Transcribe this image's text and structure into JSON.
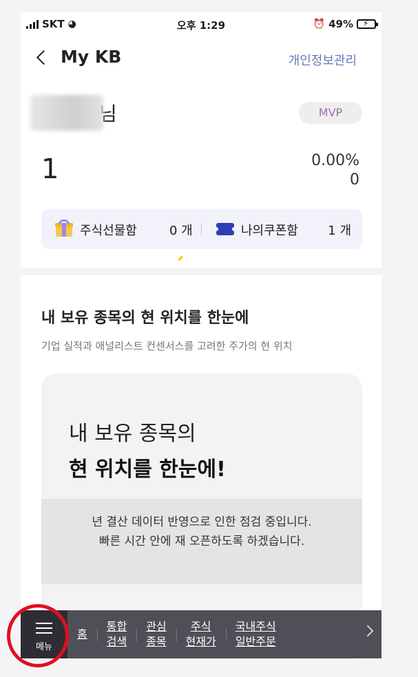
{
  "status_bar": {
    "carrier": "SKT",
    "time": "오후 1:29",
    "battery": "49%"
  },
  "header": {
    "title": "My KB",
    "privacy_link": "개인정보관리"
  },
  "profile": {
    "honorific": "님",
    "grade": "MVP",
    "value": "1",
    "rate": "0.00%",
    "change": "0"
  },
  "gift_box": {
    "gift_label": "주식선물함",
    "gift_count": "0 개",
    "coupon_label": "나의쿠폰함",
    "coupon_count": "1 개"
  },
  "section": {
    "title": "내 보유 종목의 현 위치를 한눈에",
    "subtitle": "기업 실적과 애널리스트 컨센서스를 고려한 주가의 현 위치"
  },
  "card": {
    "line1": "내 보유 종목의",
    "line2": "현 위치를 한눈에!",
    "notice_line1": "년 결산 데이터 반영으로 인한 점검 중입니다.",
    "notice_line2": "빠른 시간 안에 재 오픈하도록 하겠습니다."
  },
  "bottom_nav": {
    "menu_label": "메뉴",
    "items": [
      {
        "line1": "홈",
        "line2": ""
      },
      {
        "line1": "통합",
        "line2": "검색"
      },
      {
        "line1": "관심",
        "line2": "종목"
      },
      {
        "line1": "주식",
        "line2": "현재가"
      },
      {
        "line1": "국내주식",
        "line2": "일반주문"
      }
    ]
  },
  "colors": {
    "accent_link": "#6b78b8",
    "mvp_text": "#9b6fb2",
    "nav_bg": "#4f4f58",
    "highlight": "#e10f1e"
  }
}
